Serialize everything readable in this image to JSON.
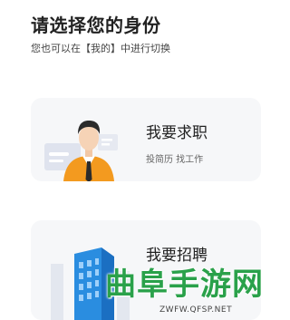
{
  "header": {
    "title": "请选择您的身份",
    "subtitle": "您也可以在【我的】中进行切换"
  },
  "cards": [
    {
      "title": "我要求职",
      "description": "投简历 找工作"
    },
    {
      "title": "我要招聘",
      "description": ""
    }
  ],
  "watermark": {
    "text": "曲阜手游网",
    "url_text": "ZWFW.QFSP.NET"
  },
  "colors": {
    "card_bg": "#f6f7f9",
    "person_shirt": "#f39a1f",
    "building_blue": "#2a8de0",
    "watermark_green": "#2aa14a"
  }
}
